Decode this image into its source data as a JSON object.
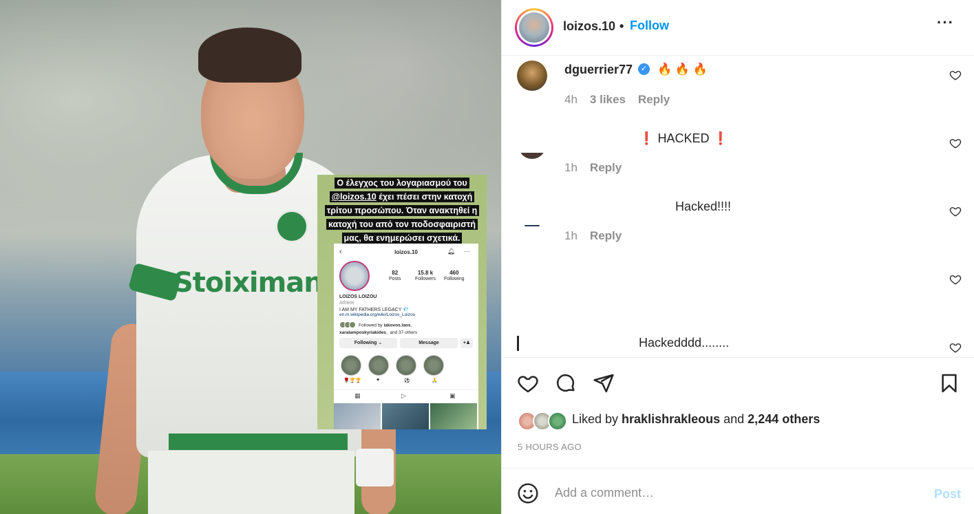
{
  "story": {
    "text_lines": [
      "Ο έλεγχος του λογαριασμού του",
      "έχει πέσει στην κατοχή",
      "τρίτου προσώπου. Όταν ανακτηθεί η",
      "κατοχή του από τον ποδοσφαιριστή",
      "μας, θα ενημερώσει σχετικά."
    ],
    "mention": "@loizos.10",
    "phone": {
      "username": "loizos.10",
      "posts_count": "82",
      "posts_label": "Posts",
      "followers_count": "15.8 k",
      "followers_label": "Followers",
      "following_count": "460",
      "following_label": "Following",
      "name": "LOIZOS LOIZOU",
      "category": "Athlete",
      "bio": "I AM MY FATHERS LEGACY 💎",
      "link": "en.m.wikipedia.org/wiki/Loizos_Loizou",
      "followed_by_prefix": "Followed by ",
      "followed_by_1": "iakovos.laos",
      "followed_by_2": "xaralamposkyriakides_",
      "followed_by_suffix": " and 37 others",
      "following_btn": "Following ⌄",
      "message_btn": "Message",
      "add_person_icon": "+♟"
    },
    "shirt_sponsor": "Stoiximan"
  },
  "header": {
    "username": "loizos.10",
    "separator": "•",
    "follow": "Follow",
    "more": "···"
  },
  "comments": [
    {
      "username": "dguerrier77",
      "verified": true,
      "text": "🔥 🔥 🔥",
      "time": "4h",
      "likes": "3 likes",
      "reply": "Reply"
    },
    {
      "text_left_mark": "❗",
      "text": "HACKED",
      "text_right_mark": "❗",
      "time": "1h",
      "reply": "Reply"
    },
    {
      "text": "Hacked!!!!",
      "time": "1h",
      "reply": "Reply"
    },
    {
      "text": ""
    },
    {
      "text": "Hackedddd........"
    }
  ],
  "actions": {
    "liked_prefix": "Liked by ",
    "liked_user": "hraklishrakleous",
    "liked_and": " and ",
    "liked_others": "2,244 others",
    "time_ago": "5 HOURS AGO"
  },
  "add_comment": {
    "placeholder": "Add a comment…",
    "post": "Post"
  },
  "colors": {
    "accent": "#0095f6",
    "post_disabled": "#b2dffc",
    "muted": "#8e8e8e",
    "club_green": "#2f8a4a"
  }
}
